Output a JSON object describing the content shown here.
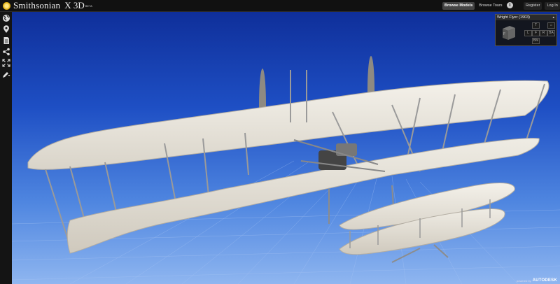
{
  "header": {
    "brand": "Smithsonian",
    "product": "X 3D",
    "beta": "BETA",
    "nav": [
      "Browse Models",
      "Browse Tours"
    ],
    "info_glyph": "i",
    "auth": [
      "Register",
      "Log In"
    ]
  },
  "toolbar": {
    "tools": [
      {
        "name": "globe-icon"
      },
      {
        "name": "location-pin-icon"
      },
      {
        "name": "document-icon"
      },
      {
        "name": "share-icon"
      },
      {
        "name": "fullscreen-icon"
      },
      {
        "name": "pencil-icon"
      }
    ]
  },
  "camera_panel": {
    "title": "Wright Flyer (1903)",
    "collapse_glyph": "▴",
    "cube_face": "F",
    "views": {
      "top": "T",
      "left": "L",
      "front": "F",
      "right": "R",
      "back": "BA",
      "bottom": "BM",
      "home": "⌂"
    }
  },
  "footer": {
    "powered_by": "powered by",
    "brand": "AUTODESK"
  },
  "colors": {
    "sky_top": "#0f2f9a",
    "sky_bottom": "#8fb6f0",
    "wing": "#ece8e0",
    "strut": "#9a9a9a"
  }
}
